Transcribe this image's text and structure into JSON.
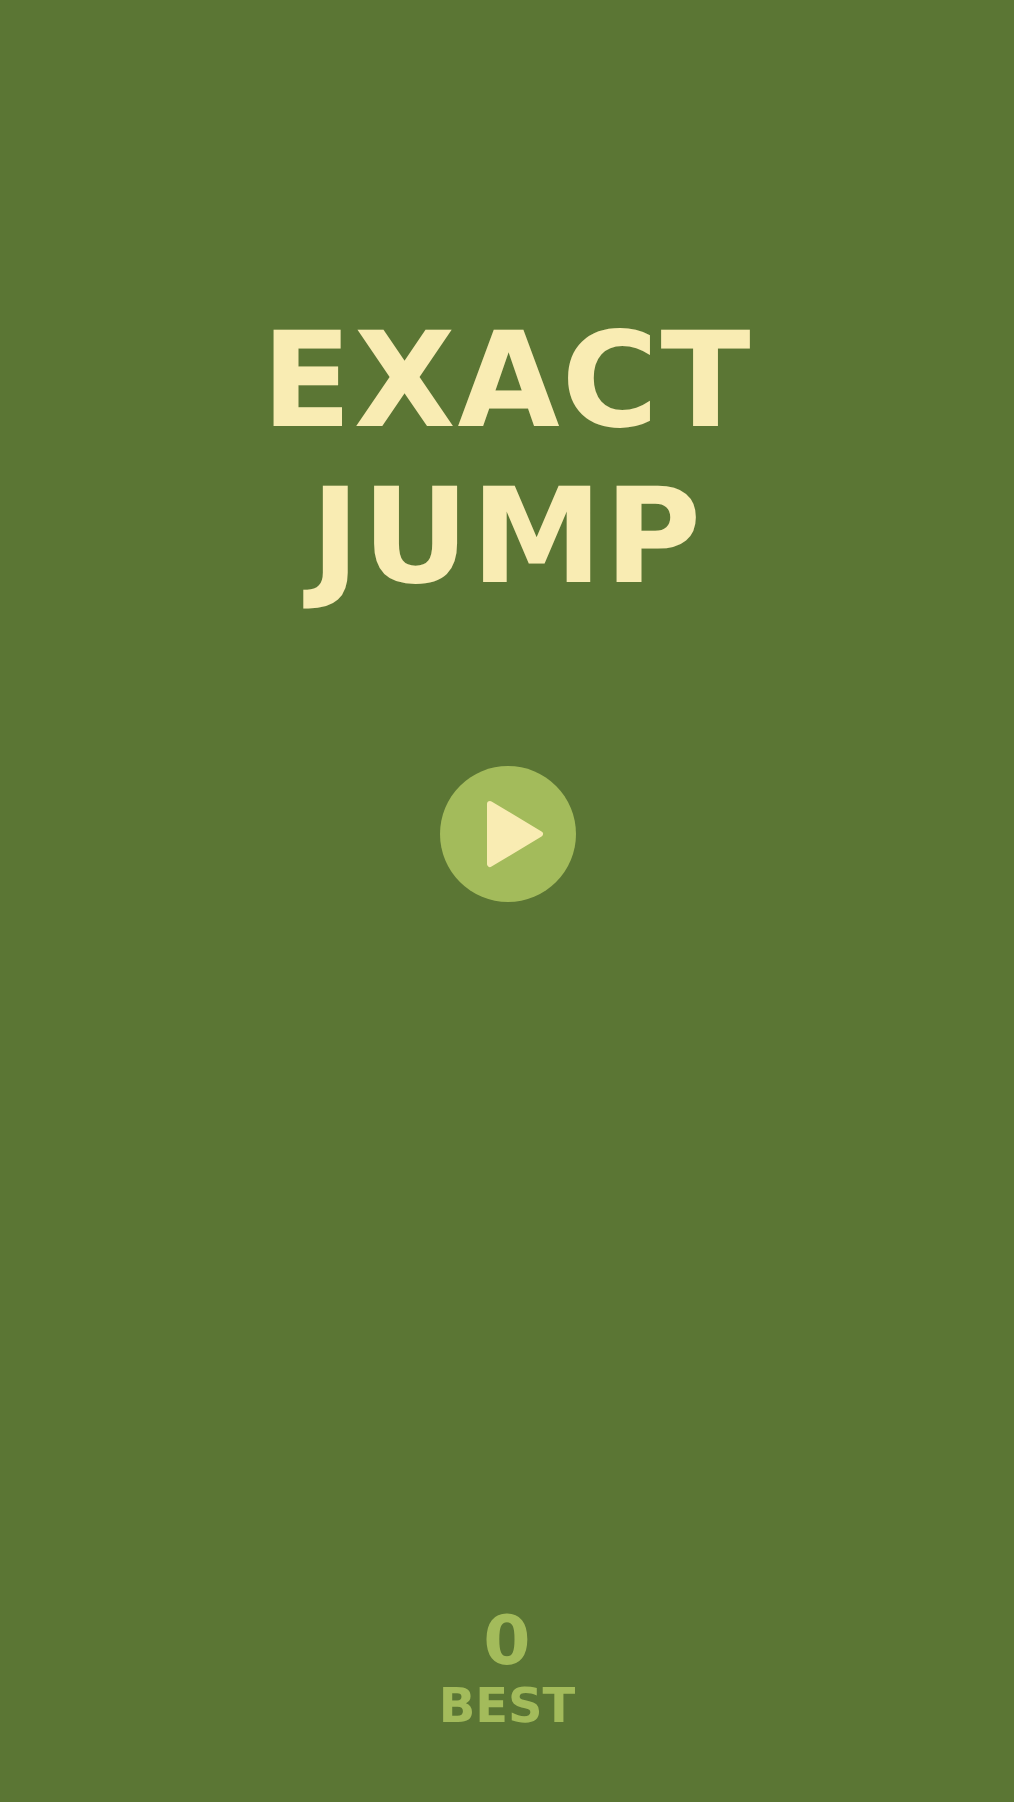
{
  "title": [
    "EXACT",
    "JUMP"
  ],
  "score": {
    "value": "0",
    "label": "BEST"
  }
}
